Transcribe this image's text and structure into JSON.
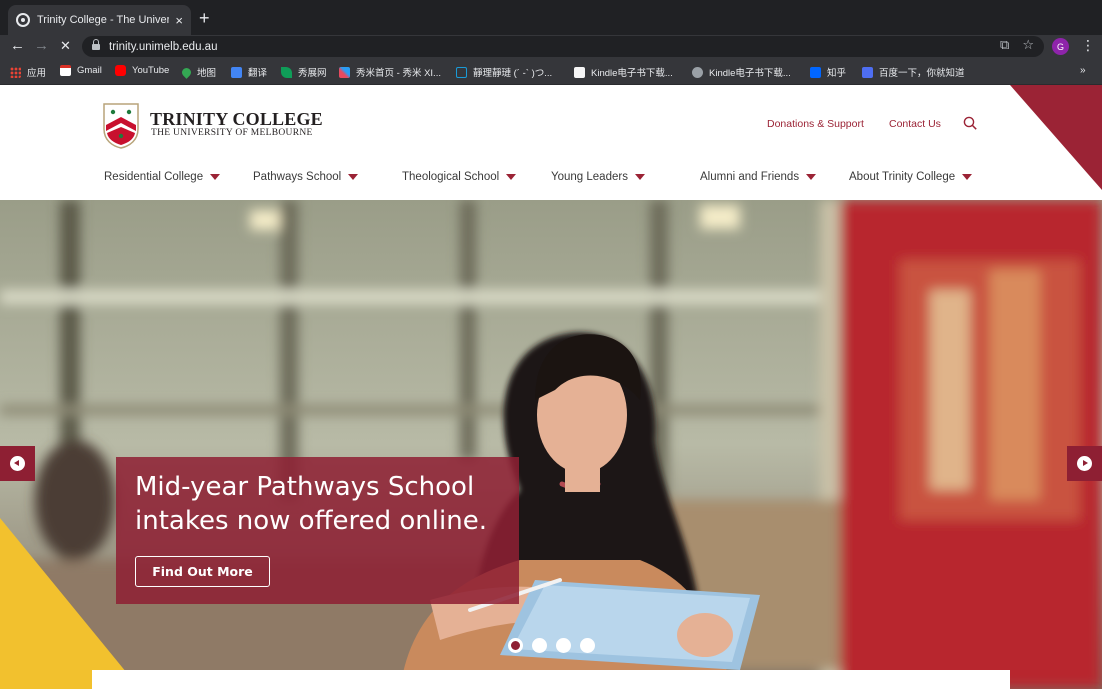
{
  "browser": {
    "tab_title": "Trinity College - The University",
    "tab_close": "×",
    "new_tab": "+",
    "url": "trinity.unimelb.edu.au",
    "profile_initial": "G",
    "back": "←",
    "forward": "→",
    "reload": "✕",
    "translate_icon": "⧉",
    "star_icon": "☆",
    "menu": "⋮",
    "bookmarks": [
      {
        "label": "应用",
        "color": "#e8711a"
      },
      {
        "label": "Gmail",
        "color": "#d93025"
      },
      {
        "label": "YouTube",
        "color": "#ff0000"
      },
      {
        "label": "地图",
        "color": "#34a853"
      },
      {
        "label": "翻译",
        "color": "#4285f4"
      },
      {
        "label": "秀展网",
        "color": "#0f9d58"
      },
      {
        "label": "秀米首页 - 秀米 XI...",
        "color": "#e84a5f"
      },
      {
        "label": "靜理靜璉 (´ -` )つ...",
        "color": "#1a9bd7"
      },
      {
        "label": "Kindle电子书下载...",
        "color": "#f5f5f5"
      },
      {
        "label": "Kindle电子书下载...",
        "color": "#9aa0a6"
      },
      {
        "label": "知乎",
        "color": "#0066ff"
      },
      {
        "label": "百度一下，你就知道",
        "color": "#4e6ef2"
      }
    ],
    "bookmarks_more": "»"
  },
  "site": {
    "logo_title": "TRINITY COLLEGE",
    "logo_subtitle": "THE UNIVERSITY OF MELBOURNE",
    "utility_links": [
      "Donations & Support",
      "Contact Us"
    ],
    "nav": [
      "Residential College",
      "Pathways School",
      "Theological School",
      "Young Leaders",
      "Alumni and Friends",
      "About Trinity College"
    ],
    "colors": {
      "brand": "#9b2335",
      "accent_yellow": "#f2c12e"
    }
  },
  "hero": {
    "caption": "Mid-year Pathways School intakes now offered online.",
    "button": "Find Out More",
    "slides_total": 4,
    "active_slide": 1
  }
}
